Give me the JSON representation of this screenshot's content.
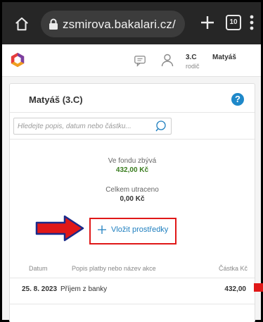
{
  "browser": {
    "url": "zsmirova.bakalari.cz/",
    "tab_count": "10"
  },
  "header": {
    "user_class": "3.C",
    "user_role": "rodič",
    "user_name": "Matyáš"
  },
  "card": {
    "title": "Matyáš (3.C)",
    "help": "?",
    "search_placeholder": "Hledejte popis, datum nebo částku..."
  },
  "fund": {
    "remaining_label": "Ve fondu zbývá",
    "remaining_value": "432,00 Kč",
    "spent_label": "Celkem utraceno",
    "spent_value": "0,00 Kč"
  },
  "actions": {
    "add_funds_label": "Vložit prostředky"
  },
  "table": {
    "headers": [
      "Datum",
      "Popis platby nebo název akce",
      "Částka Kč"
    ],
    "rows": [
      {
        "date": "25. 8. 2023",
        "description": "Příjem z banky",
        "amount": "432,00"
      }
    ]
  },
  "colors": {
    "accent_blue": "#1f7fbf",
    "positive_green": "#3a7d1f",
    "highlight_red": "#e01818"
  },
  "icons": [
    "home-icon",
    "lock-icon",
    "plus-icon",
    "tabs-icon",
    "more-vert-icon",
    "logo-icon",
    "message-icon",
    "user-icon",
    "help-icon",
    "search-icon",
    "arrow-icon"
  ]
}
